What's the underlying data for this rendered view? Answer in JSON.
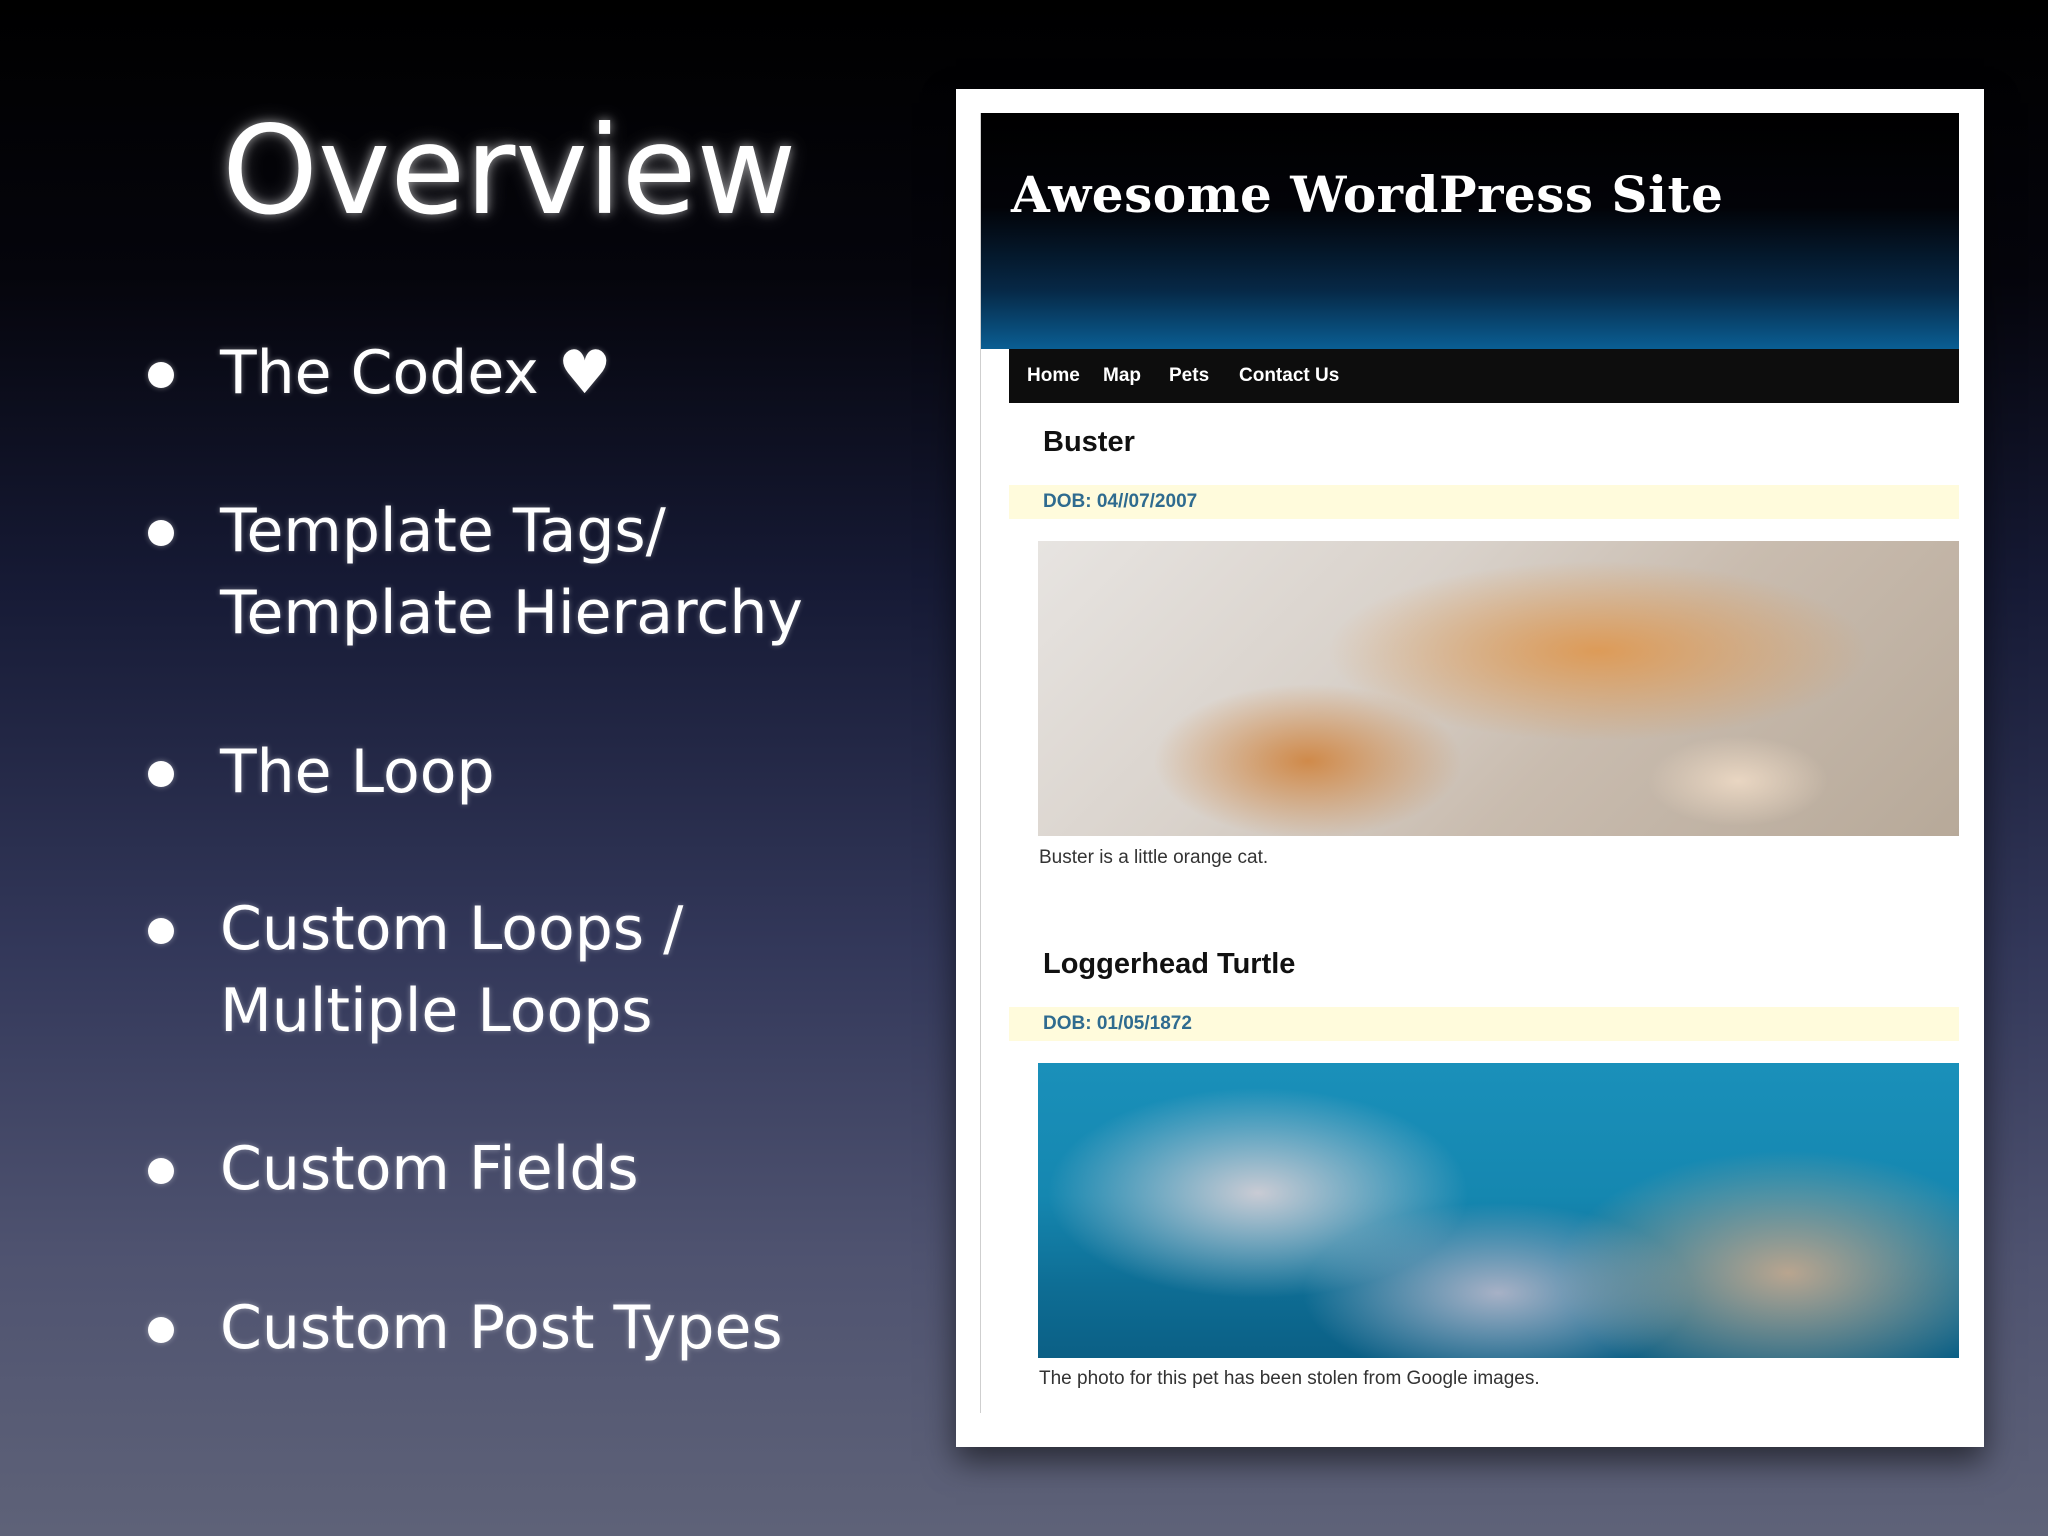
{
  "slide": {
    "title": "Overview",
    "bullets": [
      "The Codex ♥",
      "Template Tags/\nTemplate Hierarchy",
      "The Loop",
      "Custom Loops /\nMultiple Loops",
      "Custom Fields",
      "Custom Post Types"
    ]
  },
  "site": {
    "title": "Awesome WordPress Site",
    "nav": [
      "Home",
      "Map",
      "Pets",
      "Contact Us"
    ],
    "posts": [
      {
        "title": "Buster",
        "dob": "DOB: 04//07/2007",
        "caption": "Buster is a little orange cat."
      },
      {
        "title": "Loggerhead Turtle",
        "dob": "DOB: 01/05/1872",
        "caption": "The photo for this pet has been stolen from Google images."
      }
    ]
  }
}
